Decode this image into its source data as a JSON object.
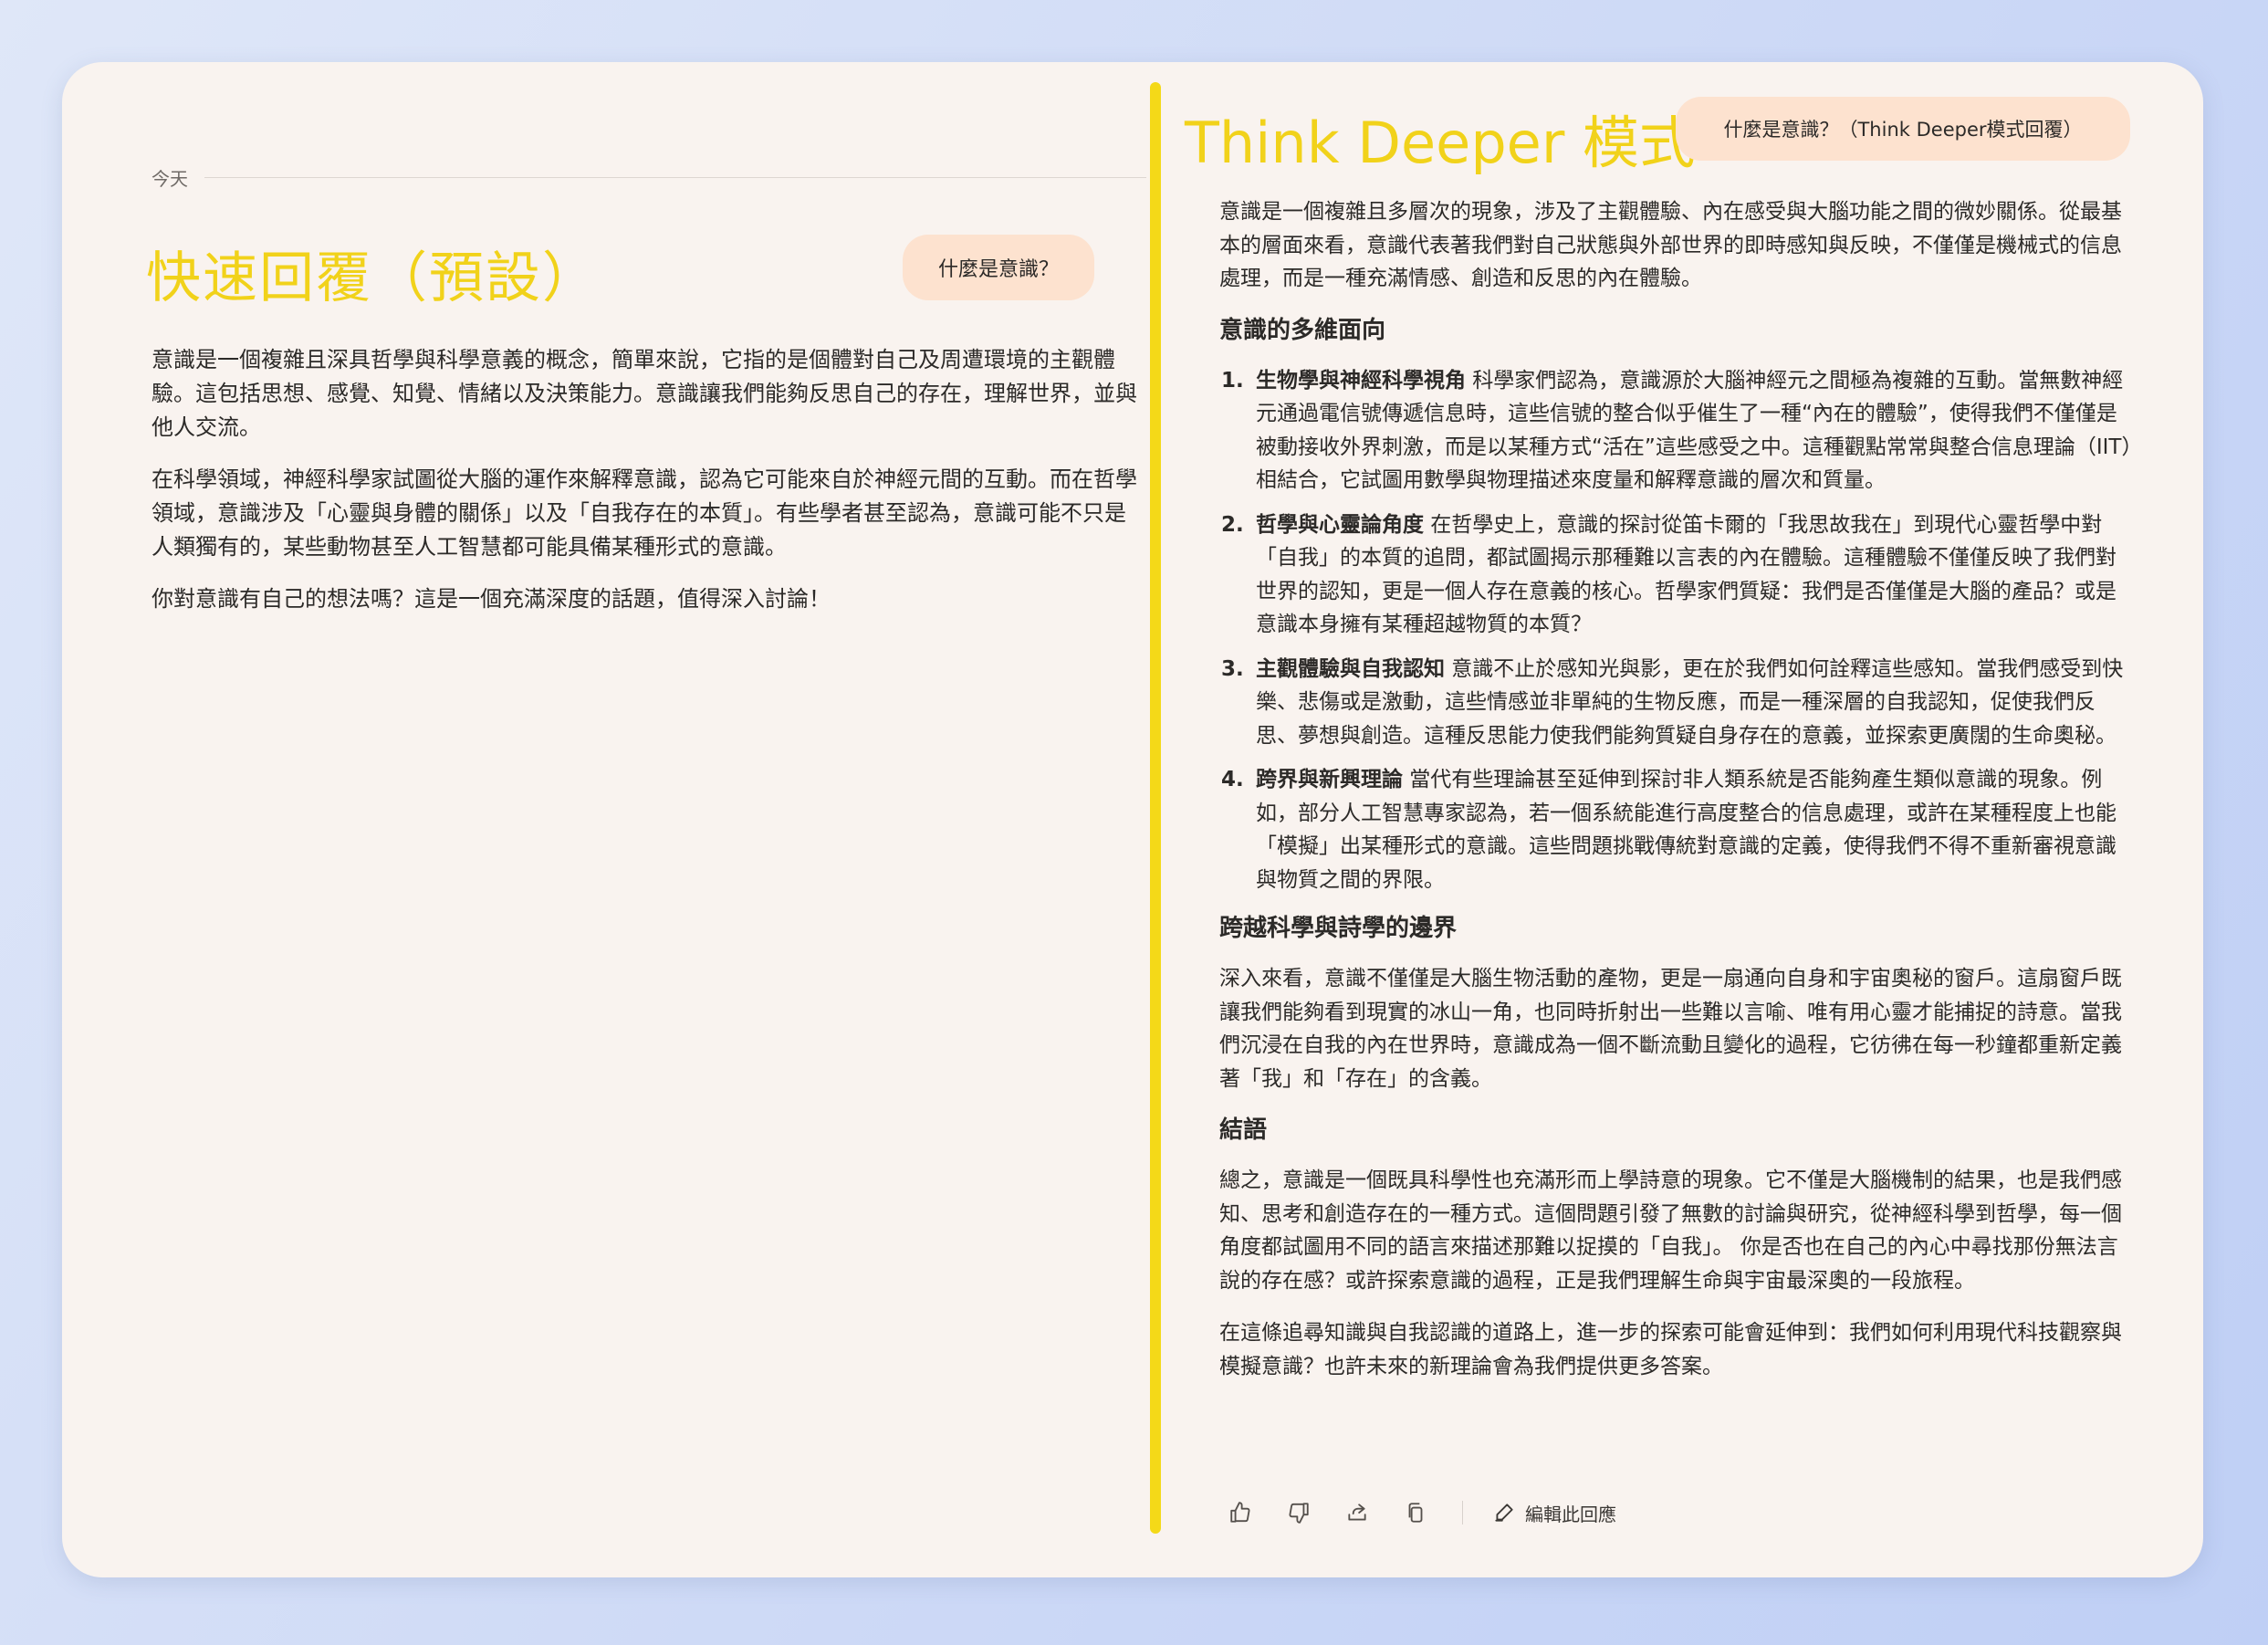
{
  "left": {
    "date_label": "今天",
    "title": "快速回覆（預設）",
    "question": "什麼是意識？",
    "paragraphs": [
      "意識是一個複雜且深具哲學與科學意義的概念，簡單來說，它指的是個體對自己及周遭環境的主觀體驗。這包括思想、感覺、知覺、情緒以及決策能力。意識讓我們能夠反思自己的存在，理解世界，並與他人交流。",
      "在科學領域，神經科學家試圖從大腦的運作來解釋意識，認為它可能來自於神經元間的互動。而在哲學領域，意識涉及「心靈與身體的關係」以及「自我存在的本質」。有些學者甚至認為，意識可能不只是人類獨有的，某些動物甚至人工智慧都可能具備某種形式的意識。",
      "你對意識有自己的想法嗎？這是一個充滿深度的話題，值得深入討論！"
    ]
  },
  "right": {
    "title": "Think Deeper 模式",
    "question": "什麼是意識？（Think Deeper模式回覆）",
    "intro": "意識是一個複雜且多層次的現象，涉及了主觀體驗、內在感受與大腦功能之間的微妙關係。從最基本的層面來看，意識代表著我們對自己狀態與外部世界的即時感知與反映，不僅僅是機械式的信息處理，而是一種充滿情感、創造和反思的內在體驗。",
    "section1_heading": "意識的多維面向",
    "list": [
      {
        "num": "1.",
        "term": "生物學與神經科學視角",
        "text": " 科學家們認為，意識源於大腦神經元之間極為複雜的互動。當無數神經元通過電信號傳遞信息時，這些信號的整合似乎催生了一種“內在的體驗”，使得我們不僅僅是被動接收外界刺激，而是以某種方式“活在”這些感受之中。這種觀點常常與整合信息理論（IIT）相結合，它試圖用數學與物理描述來度量和解釋意識的層次和質量。"
      },
      {
        "num": "2.",
        "term": "哲學與心靈論角度",
        "text": " 在哲學史上，意識的探討從笛卡爾的「我思故我在」到現代心靈哲學中對「自我」的本質的追問，都試圖揭示那種難以言表的內在體驗。這種體驗不僅僅反映了我們對世界的認知，更是一個人存在意義的核心。哲學家們質疑：我們是否僅僅是大腦的產品？或是意識本身擁有某種超越物質的本質？"
      },
      {
        "num": "3.",
        "term": "主觀體驗與自我認知",
        "text": " 意識不止於感知光與影，更在於我們如何詮釋這些感知。當我們感受到快樂、悲傷或是激動，這些情感並非單純的生物反應，而是一種深層的自我認知，促使我們反思、夢想與創造。這種反思能力使我們能夠質疑自身存在的意義，並探索更廣闊的生命奧秘。"
      },
      {
        "num": "4.",
        "term": "跨界與新興理論",
        "text": " 當代有些理論甚至延伸到探討非人類系統是否能夠產生類似意識的現象。例如，部分人工智慧專家認為，若一個系統能進行高度整合的信息處理，或許在某種程度上也能「模擬」出某種形式的意識。這些問題挑戰傳統對意識的定義，使得我們不得不重新審視意識與物質之間的界限。"
      }
    ],
    "section2_heading": "跨越科學與詩學的邊界",
    "section2_text": "深入來看，意識不僅僅是大腦生物活動的產物，更是一扇通向自身和宇宙奧秘的窗戶。這扇窗戶既讓我們能夠看到現實的冰山一角，也同時折射出一些難以言喻、唯有用心靈才能捕捉的詩意。當我們沉浸在自我的內在世界時，意識成為一個不斷流動且變化的過程，它彷彿在每一秒鐘都重新定義著「我」和「存在」的含義。",
    "section3_heading": "結語",
    "section3_text1": "總之，意識是一個既具科學性也充滿形而上學詩意的現象。它不僅是大腦機制的結果，也是我們感知、思考和創造存在的一種方式。這個問題引發了無數的討論與研究，從神經科學到哲學，每一個角度都試圖用不同的語言來描述那難以捉摸的「自我」。 你是否也在自己的內心中尋找那份無法言說的存在感？或許探索意識的過程，正是我們理解生命與宇宙最深奧的一段旅程。",
    "section3_text2": "在這條追尋知識與自我認識的道路上，進一步的探索可能會延伸到：我們如何利用現代科技觀察與模擬意識？也許未來的新理論會為我們提供更多答案。",
    "edit_label": "編輯此回應"
  },
  "colors": {
    "accent_yellow": "#f1d21a",
    "bubble": "#fde2cf",
    "card": "#f9f3ef"
  }
}
